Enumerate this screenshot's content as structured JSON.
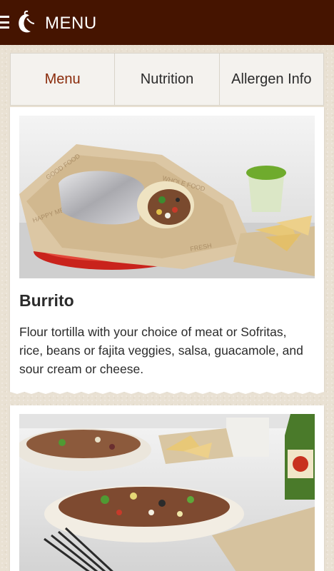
{
  "appbar": {
    "title": "MENU",
    "menu_icon": "hamburger-icon",
    "logo_icon": "chili-pepper-logo"
  },
  "tabs": [
    {
      "label": "Menu",
      "active": true
    },
    {
      "label": "Nutrition",
      "active": false
    },
    {
      "label": "Allergen Info",
      "active": false
    }
  ],
  "items": [
    {
      "title": "Burrito",
      "description": "Flour tortilla with your choice of meat or Sofritas, rice, beans or fajita veggies, salsa, guacamole, and sour cream or cheese.",
      "image": "burrito-photo"
    },
    {
      "title": "",
      "description": "",
      "image": "burrito-bowl-photo"
    }
  ],
  "colors": {
    "appbar": "#451400",
    "active_tab": "#8a2b0b",
    "background": "#e9e1d3"
  }
}
